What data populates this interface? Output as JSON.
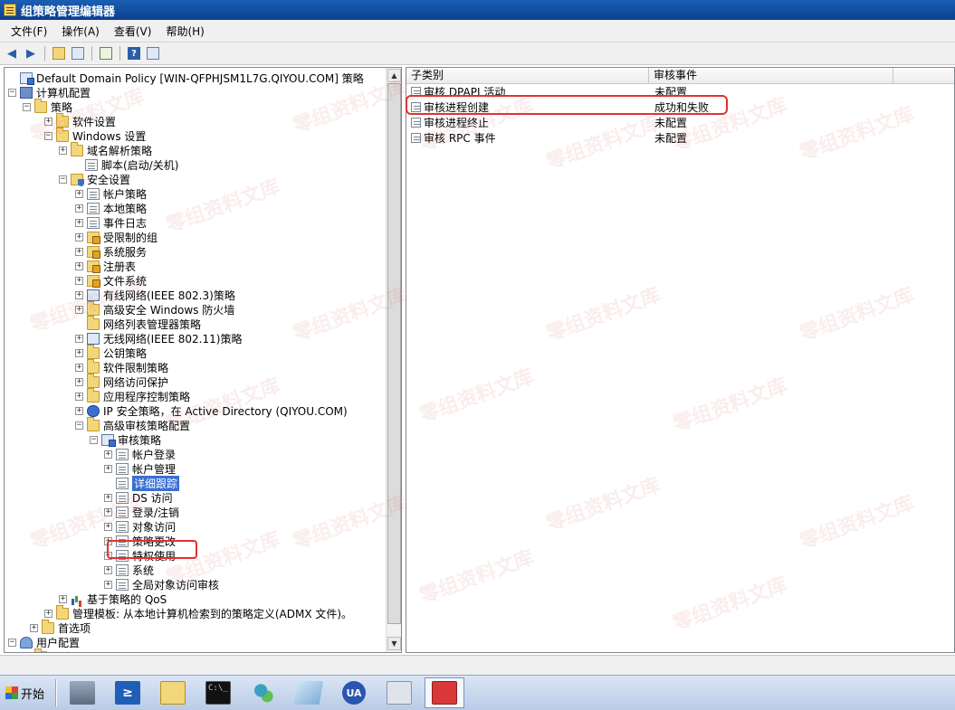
{
  "window": {
    "title": "组策略管理编辑器"
  },
  "menu": [
    "文件(F)",
    "操作(A)",
    "查看(V)",
    "帮助(H)"
  ],
  "tree": {
    "items": [
      {
        "label": "Default Domain Policy [WIN-QFPHJSM1L7G.QIYOU.COM] 策略",
        "icon": "policy-icon",
        "expander": ""
      },
      {
        "label": "计算机配置",
        "icon": "computer-icon",
        "expander": "−"
      },
      {
        "label": "策略",
        "icon": "folder-icon",
        "expander": "−"
      },
      {
        "label": "软件设置",
        "icon": "folder-icon",
        "expander": "+"
      },
      {
        "label": "Windows 设置",
        "icon": "folder-icon",
        "expander": "−"
      },
      {
        "label": "域名解析策略",
        "icon": "folder-icon",
        "expander": "+"
      },
      {
        "label": "脚本(启动/关机)",
        "icon": "document-icon",
        "expander": ""
      },
      {
        "label": "安全设置",
        "icon": "security-folder-icon",
        "expander": "−"
      },
      {
        "label": "帐户策略",
        "icon": "document-icon",
        "expander": "+"
      },
      {
        "label": "本地策略",
        "icon": "document-icon",
        "expander": "+"
      },
      {
        "label": "事件日志",
        "icon": "document-icon",
        "expander": "+"
      },
      {
        "label": "受限制的组",
        "icon": "locked-folder-icon",
        "expander": "+"
      },
      {
        "label": "系统服务",
        "icon": "locked-folder-icon",
        "expander": "+"
      },
      {
        "label": "注册表",
        "icon": "locked-folder-icon",
        "expander": "+"
      },
      {
        "label": "文件系统",
        "icon": "locked-folder-icon",
        "expander": "+"
      },
      {
        "label": "有线网络(IEEE 802.3)策略",
        "icon": "network-icon",
        "expander": "+"
      },
      {
        "label": "高级安全 Windows 防火墙",
        "icon": "folder-icon",
        "expander": "+"
      },
      {
        "label": "网络列表管理器策略",
        "icon": "folder-icon",
        "expander": ""
      },
      {
        "label": "无线网络(IEEE 802.11)策略",
        "icon": "network-icon",
        "expander": "+"
      },
      {
        "label": "公钥策略",
        "icon": "folder-icon",
        "expander": "+"
      },
      {
        "label": "软件限制策略",
        "icon": "folder-icon",
        "expander": "+"
      },
      {
        "label": "网络访问保护",
        "icon": "folder-icon",
        "expander": "+"
      },
      {
        "label": "应用程序控制策略",
        "icon": "folder-icon",
        "expander": "+"
      },
      {
        "label": "IP 安全策略，在 Active Directory (QIYOU.COM)",
        "icon": "ipsec-icon",
        "expander": "+"
      },
      {
        "label": "高级审核策略配置",
        "icon": "folder-icon",
        "expander": "−"
      },
      {
        "label": "审核策略",
        "icon": "policy-icon",
        "expander": "−"
      },
      {
        "label": "帐户登录",
        "icon": "document-icon",
        "expander": "+"
      },
      {
        "label": "帐户管理",
        "icon": "document-icon",
        "expander": "+"
      },
      {
        "label": "详细跟踪",
        "icon": "document-icon",
        "expander": "",
        "selected": true
      },
      {
        "label": "DS 访问",
        "icon": "document-icon",
        "expander": "+"
      },
      {
        "label": "登录/注销",
        "icon": "document-icon",
        "expander": "+"
      },
      {
        "label": "对象访问",
        "icon": "document-icon",
        "expander": "+"
      },
      {
        "label": "策略更改",
        "icon": "document-icon",
        "expander": "+"
      },
      {
        "label": "特权使用",
        "icon": "document-icon",
        "expander": "+"
      },
      {
        "label": "系统",
        "icon": "document-icon",
        "expander": "+"
      },
      {
        "label": "全局对象访问审核",
        "icon": "document-icon",
        "expander": "+"
      },
      {
        "label": "基于策略的 QoS",
        "icon": "chart-icon",
        "expander": "+"
      },
      {
        "label": "管理模板: 从本地计算机检索到的策略定义(ADMX 文件)。",
        "icon": "folder-icon",
        "expander": "+"
      },
      {
        "label": "首选项",
        "icon": "folder-icon",
        "expander": "+"
      },
      {
        "label": "用户配置",
        "icon": "user-icon",
        "expander": "−"
      },
      {
        "label": "策略",
        "icon": "folder-icon",
        "expander": "−"
      }
    ]
  },
  "list": {
    "columns": [
      "子类别",
      "审核事件"
    ],
    "rows": [
      {
        "subcategory": "审核 DPAPI 活动",
        "event": "未配置"
      },
      {
        "subcategory": "审核进程创建",
        "event": "成功和失败"
      },
      {
        "subcategory": "审核进程终止",
        "event": "未配置"
      },
      {
        "subcategory": "审核 RPC 事件",
        "event": "未配置"
      }
    ]
  },
  "taskbar": {
    "start_label": "开始",
    "apps": [
      {
        "name": "server-manager-icon"
      },
      {
        "name": "powershell-icon",
        "glyph": "≥"
      },
      {
        "name": "explorer-icon"
      },
      {
        "name": "command-prompt-icon",
        "glyph": "C:\\_"
      },
      {
        "name": "network-tools-icon"
      },
      {
        "name": "notepad-icon"
      },
      {
        "name": "ua-icon",
        "glyph": "UA"
      },
      {
        "name": "group-policy-icon"
      },
      {
        "name": "toolbox-icon",
        "active": true
      }
    ]
  },
  "watermark_text": "零组资料文库"
}
